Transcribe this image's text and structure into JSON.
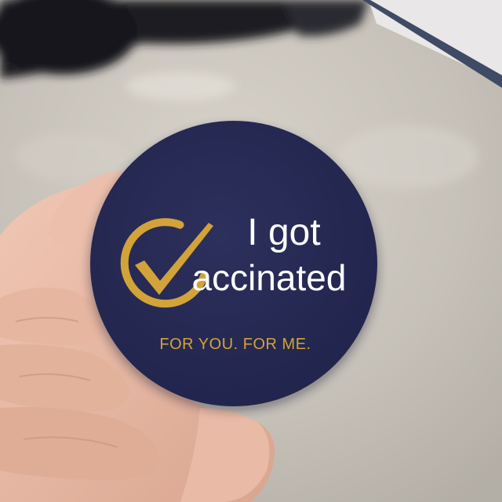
{
  "sticker": {
    "line1": "I got",
    "line2": "accinated",
    "tagline": "FOR YOU. FOR ME."
  },
  "colors": {
    "sticker_background": "#272a52",
    "sticker_headline": "#ffffff",
    "sticker_accent_gold": "#d2a338",
    "floor": "#c8c3ba",
    "wall": "#e8e6e6",
    "wall_trim": "#3f4a64",
    "skin": "#e8b9a4"
  },
  "icons": {
    "checkmark": "check-circle-icon"
  }
}
